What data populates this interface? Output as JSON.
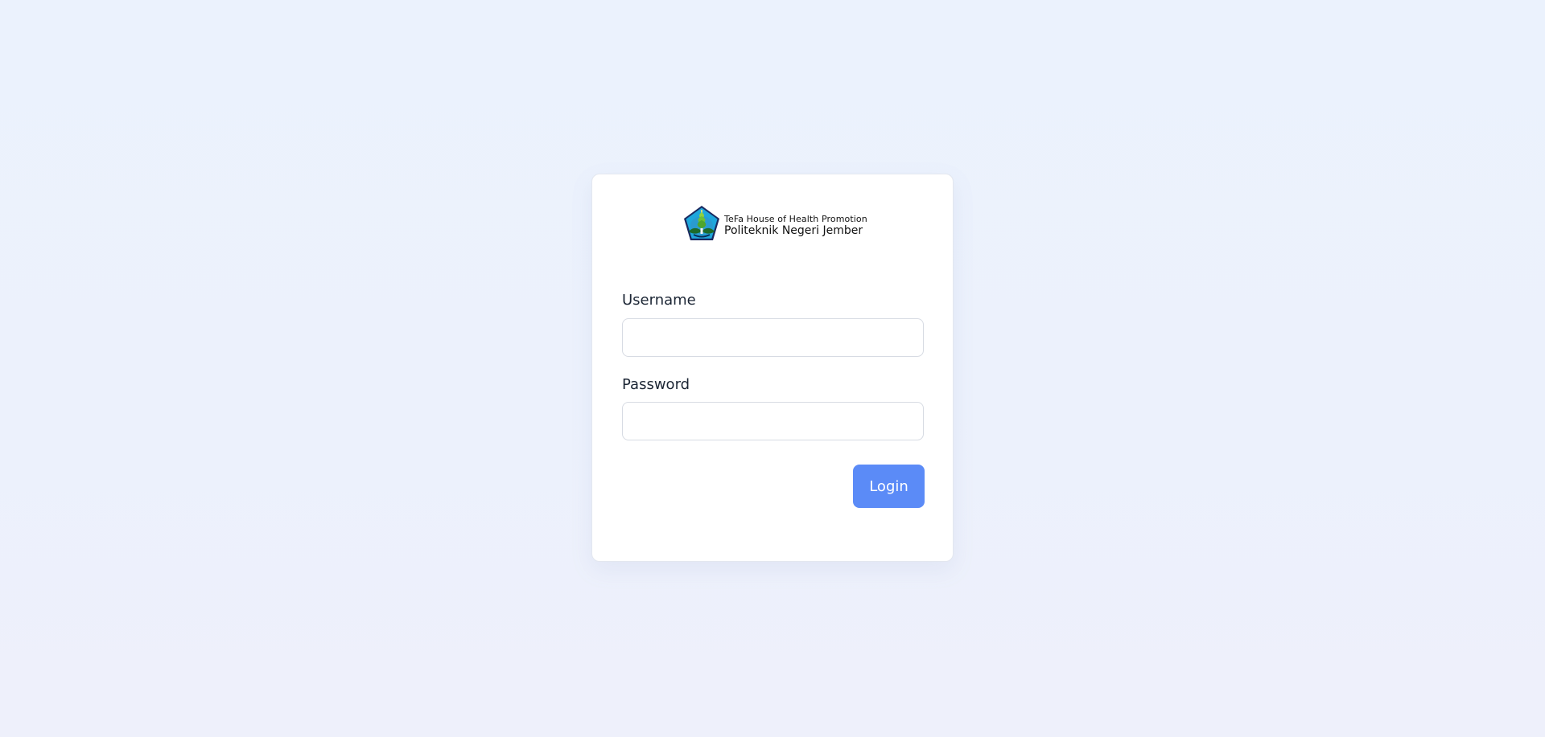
{
  "brand": {
    "line1": "TeFa House of Health Promotion",
    "line2": "Politeknik Negeri Jember",
    "icon": "polije-emblem-icon"
  },
  "form": {
    "username": {
      "label": "Username",
      "value": "",
      "placeholder": ""
    },
    "password": {
      "label": "Password",
      "value": "",
      "placeholder": ""
    },
    "submit_label": "Login"
  },
  "colors": {
    "background": "#ecf1fc",
    "card": "#ffffff",
    "button": "#5b8bf7",
    "button_text": "#ffffff",
    "label_text": "#1c2635",
    "input_border": "#d7dbe3"
  }
}
